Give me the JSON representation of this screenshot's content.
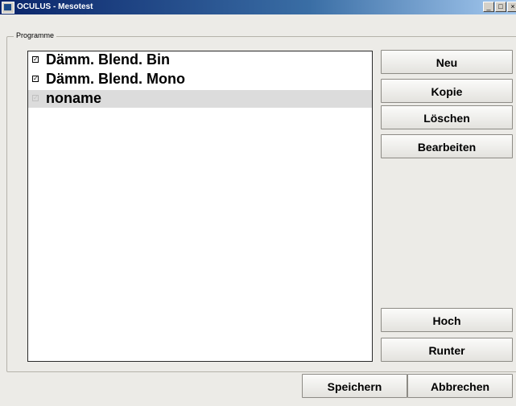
{
  "window": {
    "title": "OCULUS - Mesotest",
    "controls": {
      "minimize": "_",
      "maximize": "□",
      "close": "×"
    }
  },
  "group": {
    "label": "Programme"
  },
  "programs": [
    {
      "label": "Dämm. Blend. Bin",
      "checked": true,
      "selected": false
    },
    {
      "label": "Dämm. Blend. Mono",
      "checked": true,
      "selected": false
    },
    {
      "label": "noname",
      "checked": true,
      "selected": true,
      "disabled": true
    }
  ],
  "side_buttons": {
    "new": "Neu",
    "copy": "Kopie",
    "delete": "Löschen",
    "edit": "Bearbeiten",
    "up": "Hoch",
    "down": "Runter"
  },
  "footer": {
    "save": "Speichern",
    "cancel": "Abbrechen"
  },
  "colors": {
    "title_gradient_start": "#0a246a",
    "title_gradient_end": "#a6caf0",
    "window_bg": "#ecebe7",
    "selected_row": "#dcdcdc"
  }
}
